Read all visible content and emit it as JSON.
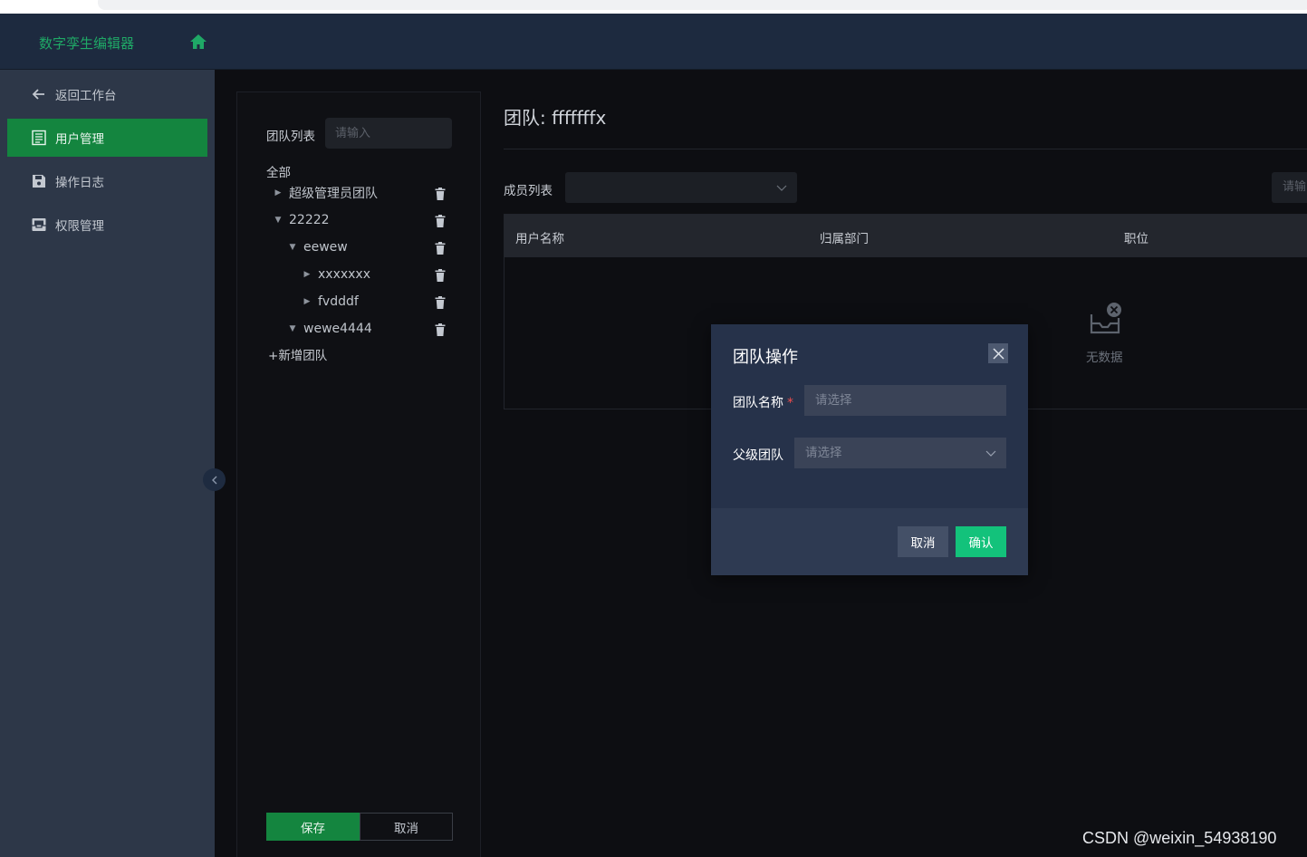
{
  "app": {
    "title": "数字孪生编辑器"
  },
  "sidebar": {
    "items": [
      {
        "label": "返回工作台",
        "icon": "arrow-left-icon",
        "active": false
      },
      {
        "label": "用户管理",
        "icon": "document-icon",
        "active": true
      },
      {
        "label": "操作日志",
        "icon": "save-icon",
        "active": false
      },
      {
        "label": "权限管理",
        "icon": "inbox-icon",
        "active": false
      }
    ]
  },
  "team_panel": {
    "label": "团队列表",
    "search_placeholder": "请输入",
    "all_label": "全部",
    "tree": [
      {
        "label": "超级管理员团队",
        "expanded": false
      },
      {
        "label": "22222",
        "expanded": true
      },
      {
        "label": "eewew",
        "expanded": true
      },
      {
        "label": "xxxxxxx",
        "expanded": false
      },
      {
        "label": "fvdddf",
        "expanded": false
      },
      {
        "label": "wewe4444",
        "expanded": true
      }
    ],
    "add_label": "新增团队",
    "save_label": "保存",
    "cancel_label": "取消"
  },
  "main": {
    "title": "团队: fffffffx",
    "members_label": "成员列表",
    "search_placeholder": "请输",
    "columns": [
      "用户名称",
      "归属部门",
      "职位"
    ],
    "empty_text": "无数据"
  },
  "dialog": {
    "title": "团队操作",
    "name_label": "团队名称",
    "required_mark": "*",
    "name_placeholder": "请选择",
    "parent_label": "父级团队",
    "parent_placeholder": "请选择",
    "cancel_label": "取消",
    "ok_label": "确认"
  },
  "watermark": "CSDN @weixin_54938190",
  "colors": {
    "accent": "#14853f",
    "confirm": "#13c27b",
    "topbar": "#1d2a3f",
    "sidebar": "#2d3748",
    "dialog": "#26324a"
  }
}
